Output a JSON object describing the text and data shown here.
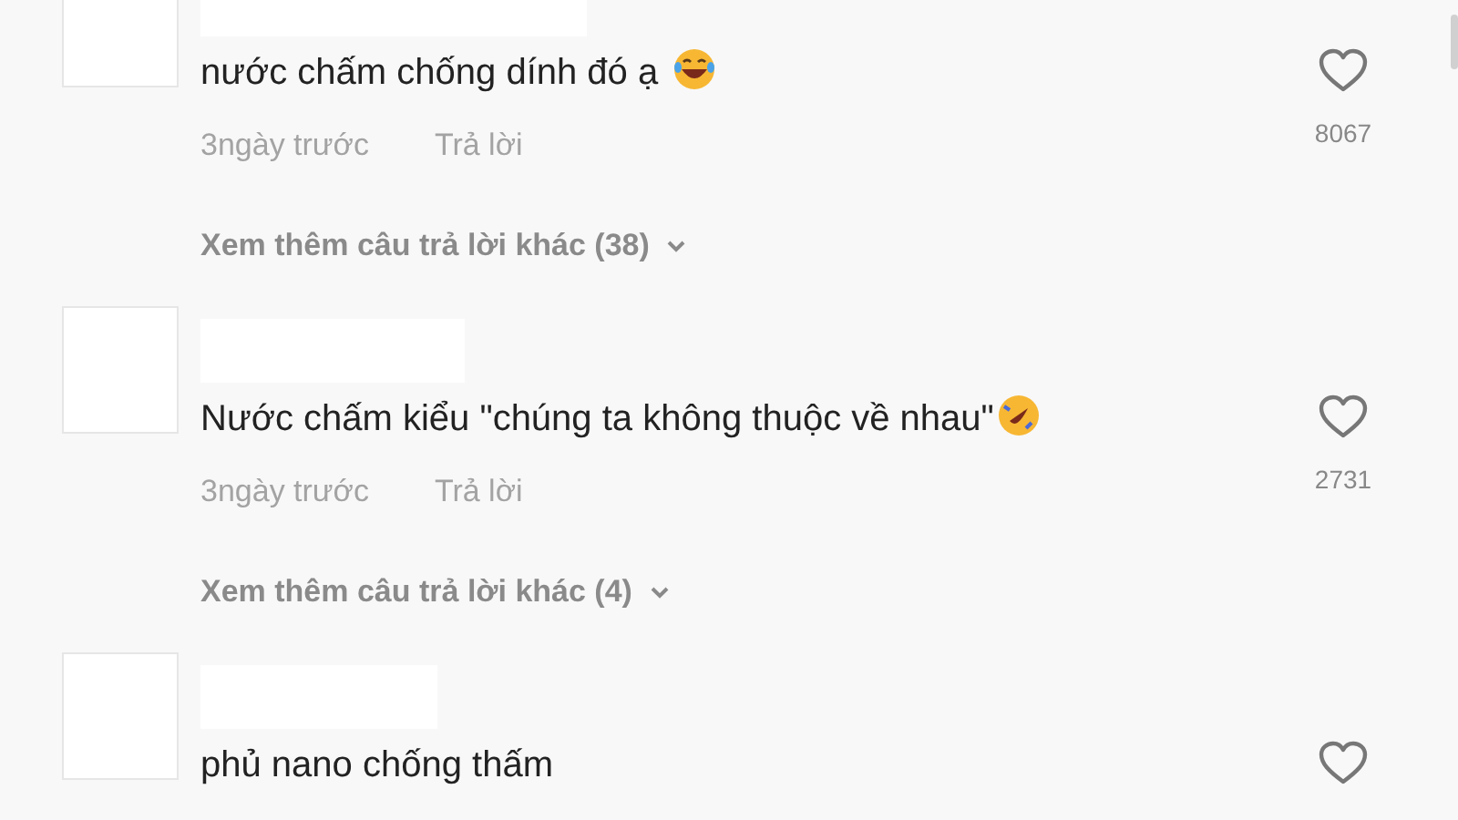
{
  "comments": [
    {
      "text": "nước chấm chống dính đó ạ",
      "emoji": {
        "kind": "tears-of-joy"
      },
      "time": "3ngày trước",
      "reply": "Trả lời",
      "likes": "8067",
      "more_replies": "Xem thêm câu trả lời khác (38)"
    },
    {
      "text": "Nước chấm kiểu \"chúng ta không thuộc về nhau\"",
      "emoji": {
        "kind": "rolling-laugh"
      },
      "time": "3ngày trước",
      "reply": "Trả lời",
      "likes": "2731",
      "more_replies": "Xem thêm câu trả lời khác (4)"
    },
    {
      "text": "phủ nano chống thấm"
    }
  ]
}
